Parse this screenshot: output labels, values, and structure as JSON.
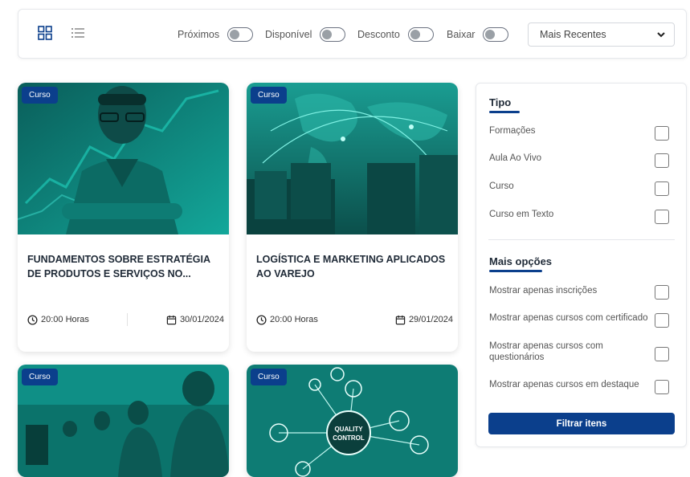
{
  "toolbar": {
    "toggles": [
      {
        "label": "Próximos"
      },
      {
        "label": "Disponível"
      },
      {
        "label": "Desconto"
      },
      {
        "label": "Baixar"
      }
    ],
    "sort": {
      "selected": "Mais Recentes"
    }
  },
  "cards": [
    {
      "badge": "Curso",
      "title": "FUNDAMENTOS SOBRE ESTRATÉGIA DE PRODUTOS E SERVIÇOS NO...",
      "duration": "20:00 Horas",
      "date": "30/01/2024"
    },
    {
      "badge": "Curso",
      "title": "LOGÍSTICA E MARKETING APLICADOS AO VAREJO",
      "duration": "20:00 Horas",
      "date": "29/01/2024"
    },
    {
      "badge": "Curso"
    },
    {
      "badge": "Curso",
      "image_text": [
        "QUALITY",
        "CONTROL"
      ]
    }
  ],
  "filters": {
    "tipo": {
      "heading": "Tipo",
      "items": [
        "Formações",
        "Aula Ao Vivo",
        "Curso",
        "Curso em Texto"
      ]
    },
    "mais": {
      "heading": "Mais opções",
      "items": [
        "Mostrar apenas inscrições",
        "Mostrar apenas cursos com certificado",
        "Mostrar apenas cursos com questionários",
        "Mostrar apenas cursos em destaque"
      ]
    },
    "button": "Filtrar itens"
  },
  "colors": {
    "accent": "#0b3f8c",
    "teal": "#0f8f86"
  }
}
